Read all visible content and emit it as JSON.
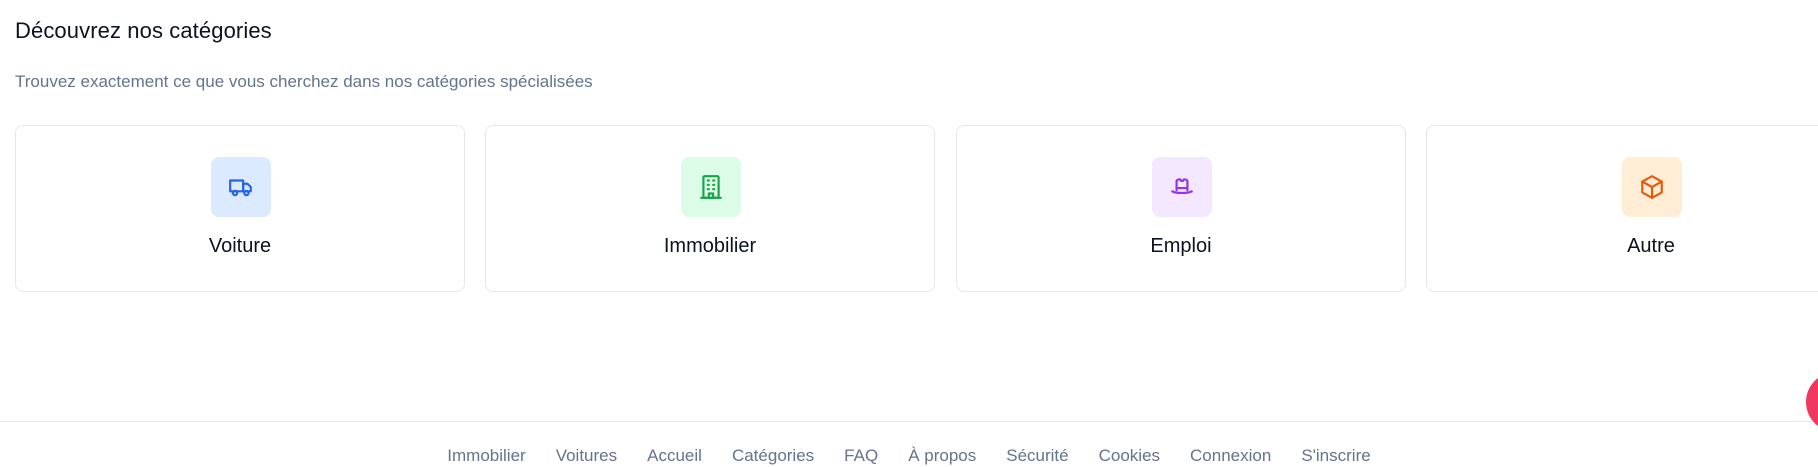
{
  "section": {
    "title": "Découvrez nos catégories",
    "subtitle": "Trouvez exactement ce que vous cherchez dans nos catégories spécialisées"
  },
  "categories": [
    {
      "label": "Voiture",
      "icon": "truck-icon",
      "bg": "#dbeafe",
      "color": "#2563eb"
    },
    {
      "label": "Immobilier",
      "icon": "building-icon",
      "bg": "#dcfce7",
      "color": "#16a34a"
    },
    {
      "label": "Emploi",
      "icon": "hat-icon",
      "bg": "#f3e8ff",
      "color": "#9333ea"
    },
    {
      "label": "Autre",
      "icon": "box-icon",
      "bg": "#ffedd5",
      "color": "#ea580c"
    }
  ],
  "footer": {
    "links": [
      "Immobilier",
      "Voitures",
      "Accueil",
      "Catégories",
      "FAQ",
      "À propos",
      "Sécurité",
      "Cookies",
      "Connexion",
      "S'inscrire"
    ]
  },
  "fab": {
    "icon": "chat-bubble-icon",
    "color": "#f0375f"
  }
}
